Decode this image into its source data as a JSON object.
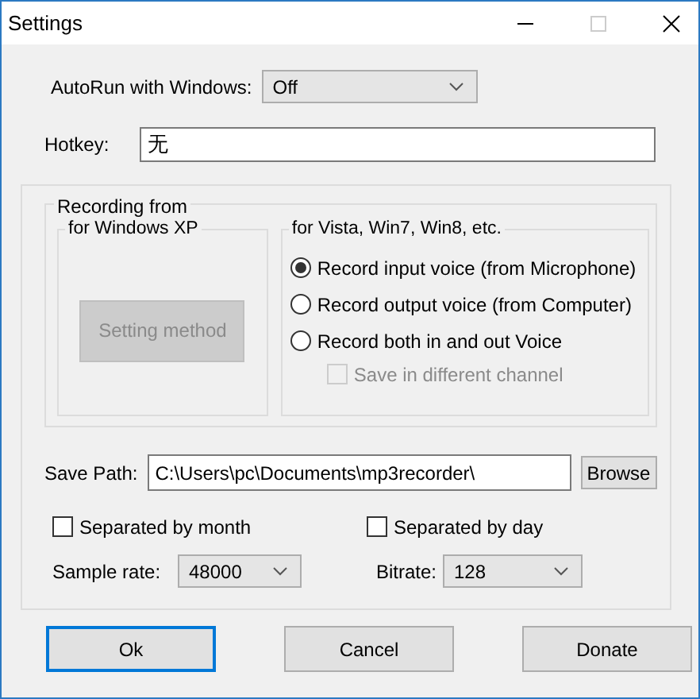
{
  "window": {
    "title": "Settings"
  },
  "autorun": {
    "label": "AutoRun with Windows:",
    "value": "Off"
  },
  "hotkey": {
    "label": "Hotkey:",
    "value": "无"
  },
  "recording": {
    "title": "Recording from",
    "xp": {
      "title": "for Windows XP",
      "button": {
        "label": "Setting method",
        "disabled": true
      }
    },
    "vista": {
      "title": "for Vista, Win7, Win8, etc.",
      "options": [
        {
          "label": "Record input voice (from Microphone)",
          "selected": true
        },
        {
          "label": "Record output voice (from Computer)",
          "selected": false
        },
        {
          "label": "Record both in and out Voice",
          "selected": false
        }
      ],
      "channel": {
        "label": "Save in different channel",
        "checked": false,
        "disabled": true
      }
    }
  },
  "save_path": {
    "label": "Save Path:",
    "value": "C:\\Users\\pc\\Documents\\mp3recorder\\",
    "button": "Browse"
  },
  "separate": [
    {
      "label": "Separated by month",
      "checked": false
    },
    {
      "label": "Separated by day",
      "checked": false
    }
  ],
  "sample_rate": {
    "label": "Sample rate:",
    "value": "48000"
  },
  "bitrate": {
    "label": "Bitrate:",
    "value": "128"
  },
  "buttons": [
    {
      "label": "Ok",
      "default": true
    },
    {
      "label": "Cancel",
      "default": false
    },
    {
      "label": "Donate",
      "default": false
    }
  ]
}
